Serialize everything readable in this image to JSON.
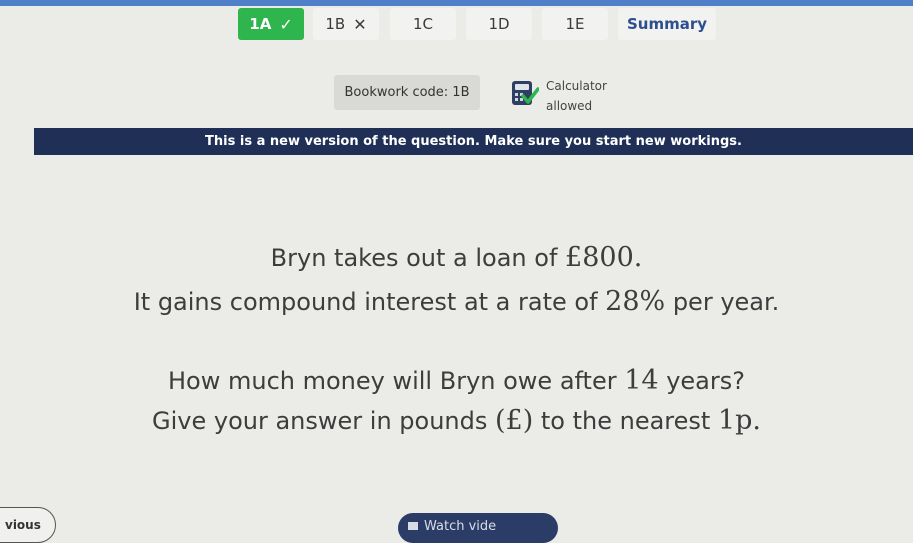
{
  "tabs": [
    {
      "label": "1A",
      "mark": "✓"
    },
    {
      "label": "1B",
      "mark": "✕"
    },
    {
      "label": "1C"
    },
    {
      "label": "1D"
    },
    {
      "label": "1E"
    },
    {
      "label": "Summary"
    }
  ],
  "bookwork": {
    "label": "Bookwork code: 1B"
  },
  "calculator": {
    "line1": "Calculator",
    "line2": "allowed",
    "icon": "calculator-icon"
  },
  "banner": {
    "text": "This is a new version of the question. Make sure you start new workings."
  },
  "question": {
    "line1_text": "Bryn takes out a loan of ",
    "line1_value": "£800.",
    "line2_text1": "It gains compound interest at a rate of ",
    "line2_value": "28%",
    "line2_text2": " per year.",
    "line3_text1": "How much money will Bryn owe after ",
    "line3_value": "14",
    "line3_text2": " years?",
    "line4_text1": "Give your answer in pounds ",
    "line4_value": "(£)",
    "line4_text2": " to the nearest ",
    "line4_value2": "1p."
  },
  "footer": {
    "previous_label": "vious",
    "watch_label": "Watch vide"
  },
  "colors": {
    "correct_tab": "#2fb54e",
    "banner": "#1f2f56",
    "summary_text": "#2c4f8e",
    "top_strip": "#4f7fc6"
  }
}
